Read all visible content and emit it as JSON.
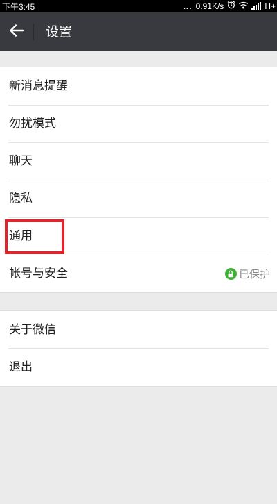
{
  "status_bar": {
    "time": "下午3:45",
    "dots": "...",
    "network_speed": "0.91K/s",
    "network_type": "H+"
  },
  "header": {
    "title": "设置"
  },
  "settings_group_1": {
    "items": [
      {
        "label": "新消息提醒"
      },
      {
        "label": "勿扰模式"
      },
      {
        "label": "聊天"
      },
      {
        "label": "隐私"
      },
      {
        "label": "通用"
      },
      {
        "label": "帐号与安全",
        "status": "已保护"
      }
    ]
  },
  "settings_group_2": {
    "items": [
      {
        "label": "关于微信"
      },
      {
        "label": "退出"
      }
    ]
  },
  "colors": {
    "title_bar": "#393a3f",
    "highlight": "#e1242b",
    "protected_badge": "#3eb135",
    "background": "#ebebeb"
  },
  "icons": [
    "back-arrow-icon",
    "alarm-icon",
    "wifi-icon",
    "signal-icon",
    "battery-icon",
    "lock-icon"
  ]
}
